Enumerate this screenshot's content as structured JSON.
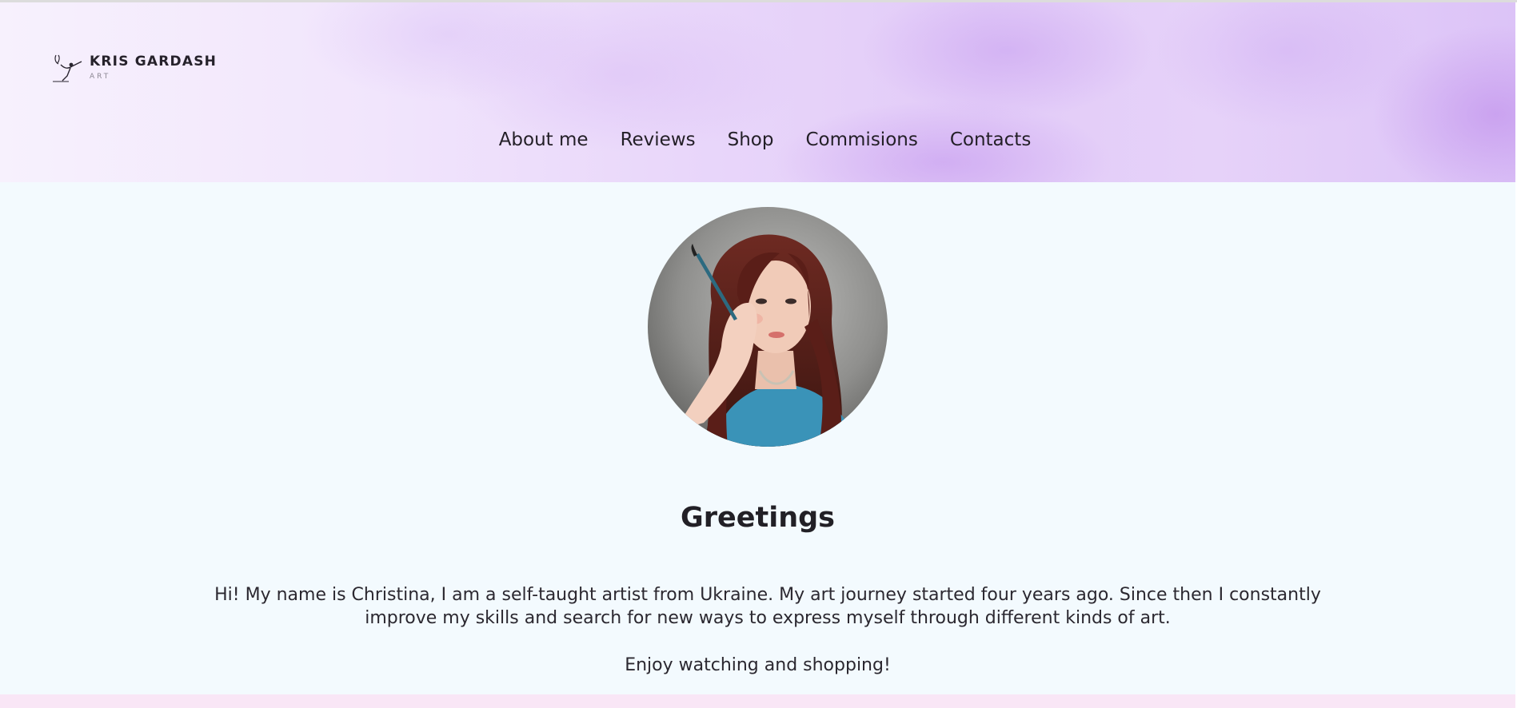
{
  "header": {
    "logo": {
      "name": "KRIS GARDASH",
      "subtitle": "ART",
      "icon": "dancer-logo-icon"
    },
    "nav": {
      "items": [
        {
          "label": "About me"
        },
        {
          "label": "Reviews"
        },
        {
          "label": "Shop"
        },
        {
          "label": "Commisions"
        },
        {
          "label": "Contacts"
        }
      ]
    }
  },
  "main": {
    "avatar": {
      "icon": "artist-portrait"
    },
    "title": "Greetings",
    "intro": "Hi! My name is Christina, I am a self-taught artist from Ukraine. My art journey started four years ago. Since then I constantly improve my skills and search for new ways to express myself through different kinds of art.",
    "closing": "Enjoy watching and shopping!"
  },
  "colors": {
    "background": "#f3fafe",
    "header_lavender": "#e2cbf8",
    "footer_band": "#f9e6f6",
    "text": "#222026"
  }
}
